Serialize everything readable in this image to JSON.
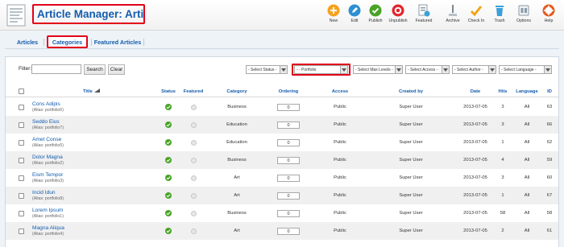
{
  "header": {
    "title": "Article Manager: Articles"
  },
  "toolbar": [
    {
      "label": "New",
      "icon": "new-icon",
      "color": "#f4a21e"
    },
    {
      "label": "Edit",
      "icon": "edit-icon",
      "color": "#2f8fd1"
    },
    {
      "label": "Publish",
      "icon": "publish-icon",
      "color": "#48a326"
    },
    {
      "label": "Unpublish",
      "icon": "unpublish-icon",
      "color": "#e3262c"
    },
    {
      "label": "Featured",
      "icon": "featured-icon",
      "color": "#8a9aa6"
    },
    {
      "label": "Archive",
      "icon": "archive-icon",
      "color": "#7a8790"
    },
    {
      "label": "Check In",
      "icon": "checkin-icon",
      "color": "#f3a31b"
    },
    {
      "label": "Trash",
      "icon": "trash-icon",
      "color": "#3aa0d9"
    },
    {
      "label": "Options",
      "icon": "options-icon",
      "color": "#8a9aa6"
    },
    {
      "label": "Help",
      "icon": "help-icon",
      "color": "#e45b1f"
    }
  ],
  "submenu": {
    "articles": "Articles",
    "categories": "Categories",
    "featured": "Featured Articles"
  },
  "filters": {
    "label": "Filter:",
    "input_value": "",
    "search_label": "Search",
    "clear_label": "Clear",
    "status": "- Select Status -",
    "category": "- - Portfolio",
    "max_levels": "- Select Max Levels -",
    "access": "- Select Access -",
    "author": "- Select Author -",
    "language": "- Select Language -"
  },
  "table": {
    "headers": {
      "title": "Title",
      "status": "Status",
      "featured": "Featured",
      "category": "Category",
      "ordering": "Ordering",
      "access": "Access",
      "created_by": "Created by",
      "date": "Date",
      "hits": "Hits",
      "language": "Language",
      "id": "ID"
    },
    "rows": [
      {
        "title": "Cons Adipis",
        "alias": "(Alias: portfolio6)",
        "category": "Business",
        "ordering": "0",
        "access": "Public",
        "created_by": "Super User",
        "date": "2013-07-05",
        "hits": "3",
        "language": "All",
        "id": "63"
      },
      {
        "title": "Seddo Eius",
        "alias": "(Alias: portfolio7)",
        "category": "Education",
        "ordering": "0",
        "access": "Public",
        "created_by": "Super User",
        "date": "2013-07-05",
        "hits": "3",
        "language": "All",
        "id": "66"
      },
      {
        "title": "Amet Conse",
        "alias": "(Alias: portfolio5)",
        "category": "Education",
        "ordering": "0",
        "access": "Public",
        "created_by": "Super User",
        "date": "2013-07-05",
        "hits": "1",
        "language": "All",
        "id": "62"
      },
      {
        "title": "Dolor Magna",
        "alias": "(Alias: portfolio2)",
        "category": "Business",
        "ordering": "0",
        "access": "Public",
        "created_by": "Super User",
        "date": "2013-07-05",
        "hits": "4",
        "language": "All",
        "id": "59"
      },
      {
        "title": "Eism Tempor",
        "alias": "(Alias: portfolio3)",
        "category": "Art",
        "ordering": "0",
        "access": "Public",
        "created_by": "Super User",
        "date": "2013-07-05",
        "hits": "3",
        "language": "All",
        "id": "60"
      },
      {
        "title": "Incid Idun",
        "alias": "(Alias: portfolio8)",
        "category": "Art",
        "ordering": "0",
        "access": "Public",
        "created_by": "Super User",
        "date": "2013-07-05",
        "hits": "1",
        "language": "All",
        "id": "67"
      },
      {
        "title": "Lorem Ipsum",
        "alias": "(Alias: portfolio1)",
        "category": "Business",
        "ordering": "0",
        "access": "Public",
        "created_by": "Super User",
        "date": "2013-07-05",
        "hits": "58",
        "language": "All",
        "id": "58"
      },
      {
        "title": "Magna Aliqua",
        "alias": "(Alias: portfolio4)",
        "category": "Art",
        "ordering": "0",
        "access": "Public",
        "created_by": "Super User",
        "date": "2013-07-05",
        "hits": "2",
        "language": "All",
        "id": "61"
      }
    ]
  },
  "colors": {
    "link": "#135cae",
    "highlight": "#e2001a",
    "published": "#48a326"
  }
}
